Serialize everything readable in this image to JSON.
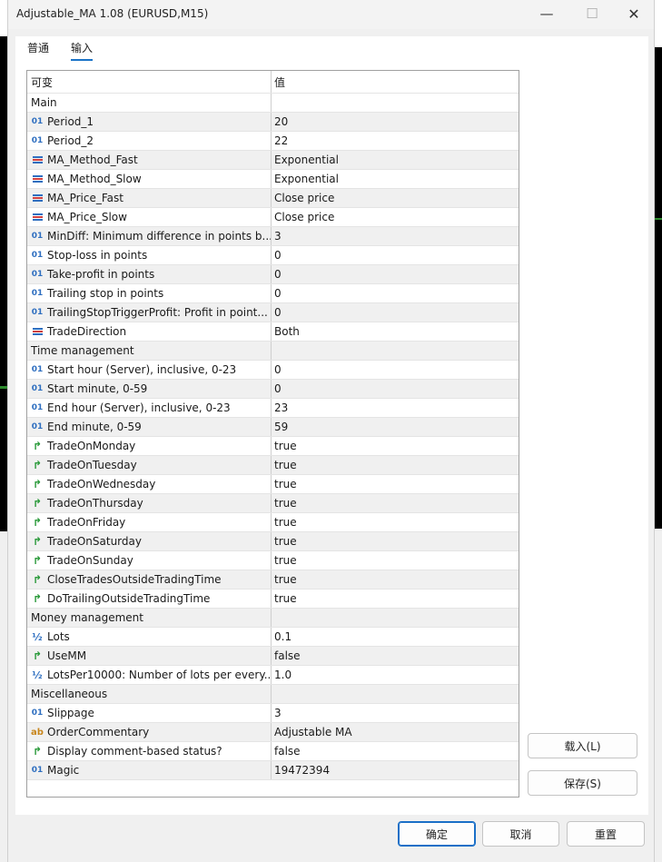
{
  "window": {
    "title": "Adjustable_MA 1.08 (EURUSD,M15)",
    "controls": {
      "minimize": "—",
      "maximize": "☐",
      "close": "✕"
    }
  },
  "tabs": [
    {
      "label": "普通",
      "active": false
    },
    {
      "label": "输入",
      "active": true
    }
  ],
  "grid": {
    "header": {
      "name": "可变",
      "value": "值"
    },
    "rows": [
      {
        "type": "section",
        "name": "Main",
        "value": ""
      },
      {
        "type": "int",
        "icon": "int-icon",
        "name": "Period_1",
        "value": "20"
      },
      {
        "type": "int",
        "icon": "int-icon",
        "name": "Period_2",
        "value": "22"
      },
      {
        "type": "enum",
        "icon": "enum-icon",
        "name": "MA_Method_Fast",
        "value": "Exponential"
      },
      {
        "type": "enum",
        "icon": "enum-icon",
        "name": "MA_Method_Slow",
        "value": "Exponential"
      },
      {
        "type": "enum",
        "icon": "enum-icon",
        "name": "MA_Price_Fast",
        "value": "Close price"
      },
      {
        "type": "enum",
        "icon": "enum-icon",
        "name": "MA_Price_Slow",
        "value": "Close price"
      },
      {
        "type": "int",
        "icon": "int-icon",
        "name": "MinDiff: Minimum difference in points b...",
        "value": "3"
      },
      {
        "type": "int",
        "icon": "int-icon",
        "name": "Stop-loss in points",
        "value": "0"
      },
      {
        "type": "int",
        "icon": "int-icon",
        "name": "Take-profit in points",
        "value": "0"
      },
      {
        "type": "int",
        "icon": "int-icon",
        "name": "Trailing stop in points",
        "value": "0"
      },
      {
        "type": "int",
        "icon": "int-icon",
        "name": "TrailingStopTriggerProfit: Profit in point...",
        "value": "0"
      },
      {
        "type": "enum",
        "icon": "enum-icon",
        "name": "TradeDirection",
        "value": "Both"
      },
      {
        "type": "section",
        "name": "Time management",
        "value": ""
      },
      {
        "type": "int",
        "icon": "int-icon",
        "name": "Start hour (Server), inclusive, 0-23",
        "value": "0"
      },
      {
        "type": "int",
        "icon": "int-icon",
        "name": "Start minute, 0-59",
        "value": "0"
      },
      {
        "type": "int",
        "icon": "int-icon",
        "name": "End hour (Server), inclusive, 0-23",
        "value": "23"
      },
      {
        "type": "int",
        "icon": "int-icon",
        "name": "End minute, 0-59",
        "value": "59"
      },
      {
        "type": "bool",
        "icon": "bool-arrow-icon",
        "name": "TradeOnMonday",
        "value": "true"
      },
      {
        "type": "bool",
        "icon": "bool-arrow-icon",
        "name": "TradeOnTuesday",
        "value": "true"
      },
      {
        "type": "bool",
        "icon": "bool-arrow-icon",
        "name": "TradeOnWednesday",
        "value": "true"
      },
      {
        "type": "bool",
        "icon": "bool-arrow-icon",
        "name": "TradeOnThursday",
        "value": "true"
      },
      {
        "type": "bool",
        "icon": "bool-arrow-icon",
        "name": "TradeOnFriday",
        "value": "true"
      },
      {
        "type": "bool",
        "icon": "bool-arrow-icon",
        "name": "TradeOnSaturday",
        "value": "true"
      },
      {
        "type": "bool",
        "icon": "bool-arrow-icon",
        "name": "TradeOnSunday",
        "value": "true"
      },
      {
        "type": "bool",
        "icon": "bool-arrow-icon",
        "name": "CloseTradesOutsideTradingTime",
        "value": "true"
      },
      {
        "type": "bool",
        "icon": "bool-arrow-icon",
        "name": "DoTrailingOutsideTradingTime",
        "value": "true"
      },
      {
        "type": "section",
        "name": "Money management",
        "value": ""
      },
      {
        "type": "double",
        "icon": "double-icon",
        "name": "Lots",
        "value": "0.1"
      },
      {
        "type": "bool",
        "icon": "bool-arrow-icon",
        "name": "UseMM",
        "value": "false"
      },
      {
        "type": "double",
        "icon": "double-icon",
        "name": "LotsPer10000: Number of lots per every...",
        "value": "1.0"
      },
      {
        "type": "section",
        "name": "Miscellaneous",
        "value": ""
      },
      {
        "type": "int",
        "icon": "int-icon",
        "name": "Slippage",
        "value": "3"
      },
      {
        "type": "string",
        "icon": "string-icon",
        "name": "OrderCommentary",
        "value": "Adjustable MA"
      },
      {
        "type": "bool",
        "icon": "bool-arrow-icon",
        "name": "Display comment-based status?",
        "value": "false"
      },
      {
        "type": "int",
        "icon": "int-icon",
        "name": "Magic",
        "value": "19472394"
      }
    ]
  },
  "side_buttons": {
    "load": "载入(L)",
    "save": "保存(S)"
  },
  "footer": {
    "ok": "确定",
    "cancel": "取消",
    "reset": "重置"
  },
  "icon_glyphs": {
    "int": "01",
    "double": "½",
    "string": "ab",
    "bool": "↱"
  },
  "colors": {
    "accent": "#1a73c7",
    "int_icon": "#2f6fc0",
    "bool_icon": "#2a9a3a",
    "string_icon": "#c8861c"
  }
}
